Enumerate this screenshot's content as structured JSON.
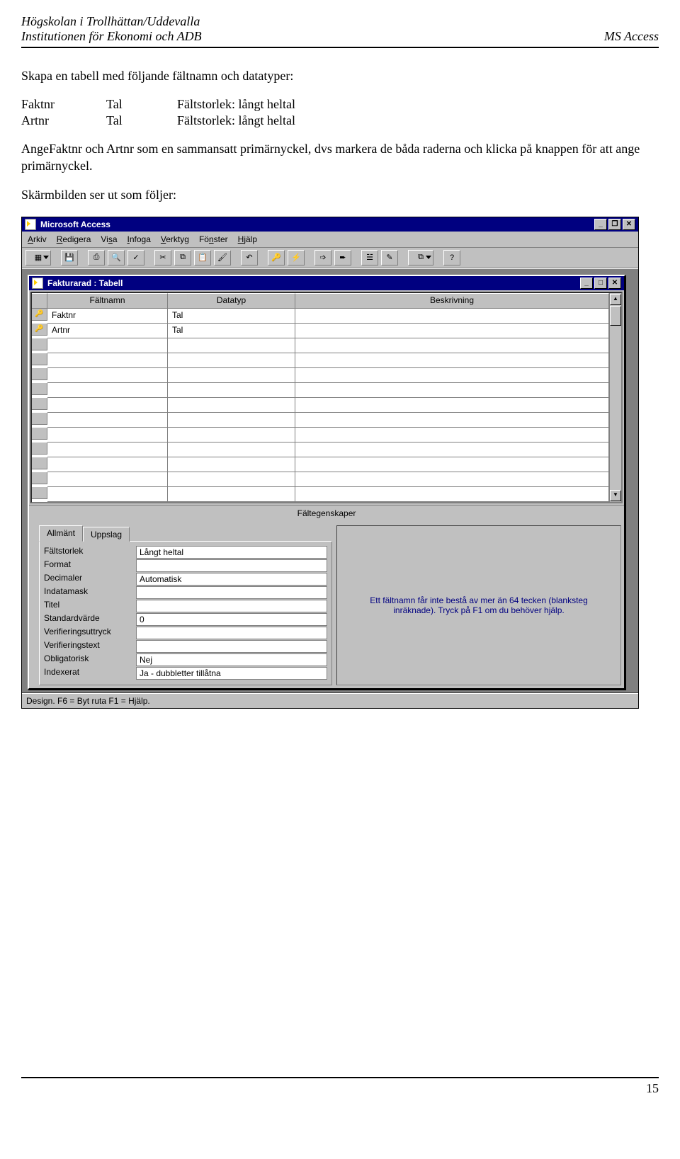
{
  "header": {
    "left1": "Högskolan i Trollhättan/Uddevalla",
    "left2": "Institutionen för Ekonomi och ADB",
    "right": "MS Access"
  },
  "body": {
    "intro": "Skapa en tabell med följande fältnamn och datatyper:",
    "field1_name": "Faktnr",
    "field1_type": "Tal",
    "field1_desc": "Fältstorlek: långt heltal",
    "field2_name": "Artnr",
    "field2_type": "Tal",
    "field2_desc": "Fältstorlek: långt heltal",
    "para2": "AngeFaktnr och Artnr som en sammansatt primärnyckel, dvs markera de båda raderna och klicka på knappen för att ange primärnyckel.",
    "para3": "Skärmbilden ser ut som följer:"
  },
  "footer": {
    "page": "15"
  },
  "shot": {
    "app_title": "Microsoft Access",
    "win_min": "_",
    "win_max": "❐",
    "win_close": "✕",
    "menu": [
      "Arkiv",
      "Redigera",
      "Visa",
      "Infoga",
      "Verktyg",
      "Fönster",
      "Hjälp"
    ],
    "inner_title": "Fakturarad : Tabell",
    "inner_win_min": "_",
    "inner_win_max": "□",
    "inner_win_close": "✕",
    "cols": {
      "field": "Fältnamn",
      "type": "Datatyp",
      "desc": "Beskrivning"
    },
    "rows": [
      {
        "key": true,
        "field": "Faktnr",
        "type": "Tal",
        "desc": ""
      },
      {
        "key": true,
        "field": "Artnr",
        "type": "Tal",
        "desc": ""
      }
    ],
    "props_title": "Fältegenskaper",
    "tabs": {
      "general": "Allmänt",
      "lookup": "Uppslag"
    },
    "props": [
      {
        "label": "Fältstorlek",
        "value": "Långt heltal"
      },
      {
        "label": "Format",
        "value": ""
      },
      {
        "label": "Decimaler",
        "value": "Automatisk"
      },
      {
        "label": "Indatamask",
        "value": ""
      },
      {
        "label": "Titel",
        "value": ""
      },
      {
        "label": "Standardvärde",
        "value": "0"
      },
      {
        "label": "Verifieringsuttryck",
        "value": ""
      },
      {
        "label": "Verifieringstext",
        "value": ""
      },
      {
        "label": "Obligatorisk",
        "value": "Nej"
      },
      {
        "label": "Indexerat",
        "value": "Ja - dubbletter tillåtna"
      }
    ],
    "hint": "Ett fältnamn får inte bestå av mer än 64 tecken (blanksteg inräknade). Tryck på F1 om du behöver hjälp.",
    "status": "Design.  F6 = Byt ruta  F1 = Hjälp."
  }
}
